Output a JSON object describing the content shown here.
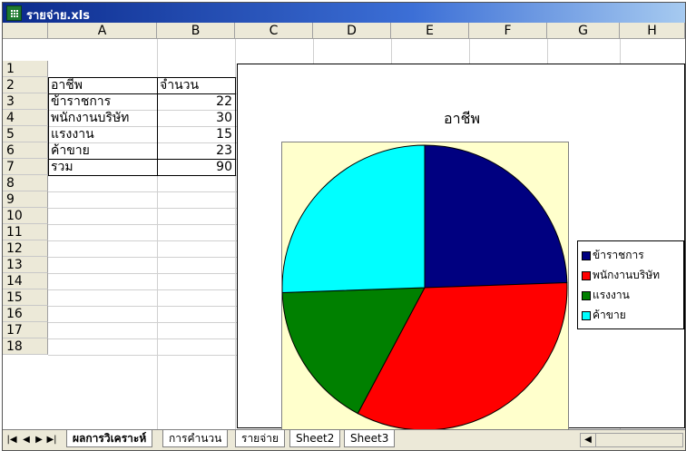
{
  "window": {
    "title": "รายจ่าย.xls",
    "icon": "excel-workbook-icon"
  },
  "columns": [
    "A",
    "B",
    "C",
    "D",
    "E",
    "F",
    "G",
    "H"
  ],
  "rows": [
    "1",
    "2",
    "3",
    "4",
    "5",
    "6",
    "7",
    "8",
    "9",
    "10",
    "11",
    "12",
    "13",
    "14",
    "15",
    "16",
    "17",
    "18"
  ],
  "table": {
    "headers": [
      "อาชีพ",
      "จำนวน"
    ],
    "rows": [
      {
        "label": "ข้าราชการ",
        "value": "22"
      },
      {
        "label": "พนักงานบริษัท",
        "value": "30"
      },
      {
        "label": "แรงงาน",
        "value": "15"
      },
      {
        "label": "ค้าขาย",
        "value": "23"
      },
      {
        "label": "รวม",
        "value": "90"
      }
    ]
  },
  "chart_data": {
    "type": "pie",
    "title": "อาชีพ",
    "categories": [
      "ข้าราชการ",
      "พนักงานบริษัท",
      "แรงงาน",
      "ค้าขาย"
    ],
    "values": [
      22,
      30,
      15,
      23
    ],
    "colors": [
      "#000080",
      "#ff0000",
      "#008000",
      "#00ffff"
    ],
    "legend_position": "right",
    "plot_background": "#ffffcc"
  },
  "sheet_tabs": {
    "active": "ผลการวิเคราะห์",
    "tabs": [
      "ผลการวิเคราะห์",
      "การคำนวน",
      "รายจ่าย",
      "Sheet2",
      "Sheet3"
    ]
  },
  "nav_icons": [
    "first-sheet-icon",
    "prev-sheet-icon",
    "next-sheet-icon",
    "last-sheet-icon"
  ]
}
